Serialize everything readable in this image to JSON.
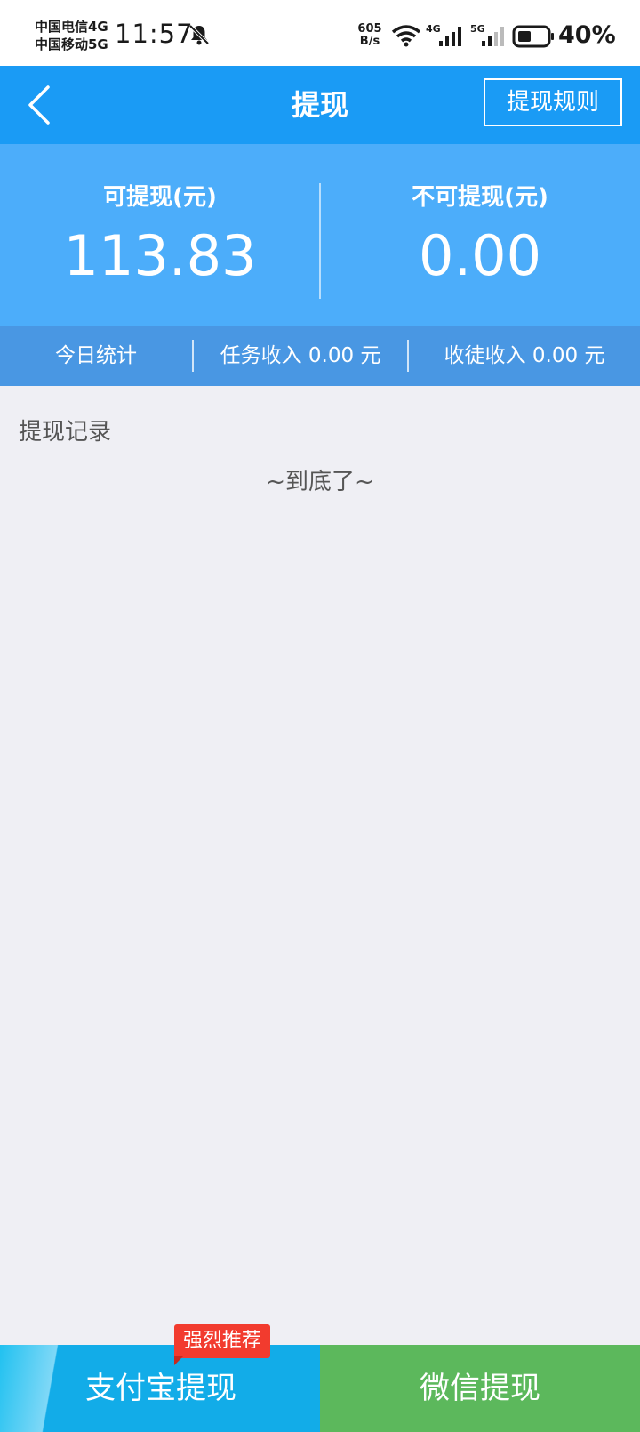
{
  "status_bar": {
    "carrier_1": "中国电信4G",
    "carrier_2": "中国移动5G",
    "time": "11:57",
    "net_speed_value": "605",
    "net_speed_unit": "B/s",
    "signal_1_label": "4G",
    "signal_2_label": "5G",
    "battery": "40%",
    "icons": [
      "bell-off-icon",
      "wifi-icon",
      "signal-icon",
      "battery-icon"
    ]
  },
  "header": {
    "title": "提现",
    "rules_button": "提现规则",
    "back_icon": "chevron-left-icon"
  },
  "balance": {
    "withdrawable_label": "可提现(元)",
    "withdrawable_value": "113.83",
    "non_withdrawable_label": "不可提现(元)",
    "non_withdrawable_value": "0.00"
  },
  "today_stats": {
    "label": "今日统计",
    "task_income": "任务收入 0.00 元",
    "apprentice_income": "收徒收入 0.00 元"
  },
  "records": {
    "title": "提现记录",
    "end_text": "~到底了~"
  },
  "bottom_actions": {
    "alipay": "支付宝提现",
    "alipay_badge": "强烈推荐",
    "wechat": "微信提现"
  },
  "colors": {
    "header_blue": "#1A9BF5",
    "panel_blue": "#4CADFA",
    "stats_blue": "#4997E3",
    "alipay_blue": "#12ACE8",
    "wechat_green": "#5CB85C",
    "badge_red": "#F23B2E",
    "background": "#EFEFF4"
  }
}
